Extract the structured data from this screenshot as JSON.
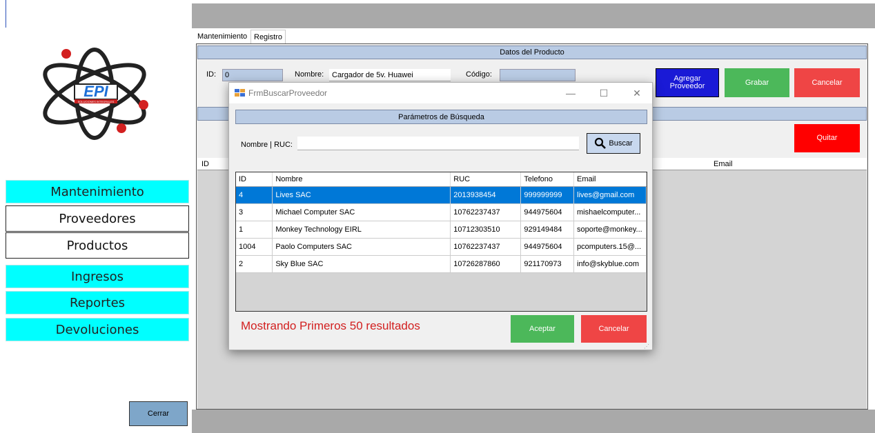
{
  "sidebar": {
    "items": [
      {
        "label": "Mantenimiento"
      },
      {
        "label": "Proveedores"
      },
      {
        "label": "Productos"
      },
      {
        "label": "Ingresos"
      },
      {
        "label": "Reportes"
      },
      {
        "label": "Devoluciones"
      }
    ],
    "close_label": "Cerrar",
    "logo_text": "EPI",
    "logo_subtext": "SOLUCIONES INTEGRALES"
  },
  "tabs": [
    {
      "label": "Mantenimiento"
    },
    {
      "label": "Registro"
    }
  ],
  "product": {
    "header": "Datos del Producto",
    "id_label": "ID:",
    "id_value": "0",
    "nombre_label": "Nombre:",
    "nombre_value": "Cargador de 5v. Huawei",
    "codigo_label": "Código:",
    "codigo_value": ""
  },
  "buttons": {
    "agregar_proveedor": "Agregar Proveedor",
    "grabar": "Grabar",
    "cancelar": "Cancelar",
    "quitar": "Quitar"
  },
  "main_grid": {
    "col_id": "ID",
    "col_email": "Email"
  },
  "dialog": {
    "title": "FrmBuscarProveedor",
    "params_header": "Parámetros de Búsqueda",
    "search_label": "Nombre | RUC:",
    "search_value": "",
    "search_button": "Buscar",
    "columns": [
      "ID",
      "Nombre",
      "RUC",
      "Telefono",
      "Email"
    ],
    "rows": [
      [
        "4",
        "Lives SAC",
        "2013938454",
        "999999999",
        "lives@gmail.com"
      ],
      [
        "3",
        "Michael Computer SAC",
        "10762237437",
        "944975604",
        "mishaelcomputer..."
      ],
      [
        "1",
        "Monkey Technology EIRL",
        "10712303510",
        "929149484",
        "soporte@monkey..."
      ],
      [
        "1004",
        "Paolo Computers SAC",
        "10762237437",
        "944975604",
        "pcomputers.15@..."
      ],
      [
        "2",
        "Sky Blue SAC",
        "10726287860",
        "921170973",
        "info@skyblue.com"
      ]
    ],
    "selected_row": 0,
    "status": "Mostrando Primeros 50 resultados",
    "accept_label": "Aceptar",
    "cancel_label": "Cancelar"
  },
  "colors": {
    "accent_cyan": "#00ffff",
    "header_blue": "#b9cbe4",
    "selection_blue": "#0078d7",
    "grabar_green": "#4cb85a",
    "cancel_red": "#ef4545",
    "quitar_red": "#ff0000",
    "agregar_blue": "#1a1ad6",
    "status_red": "#d21f1f"
  }
}
